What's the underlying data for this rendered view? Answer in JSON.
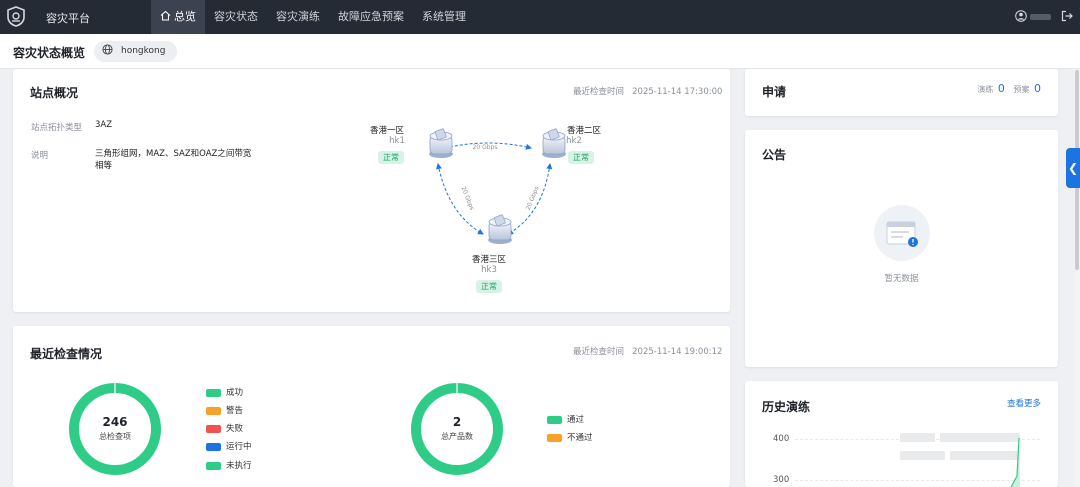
{
  "app": {
    "title": "容灾平台"
  },
  "nav": [
    {
      "label": "总览",
      "active": true
    },
    {
      "label": "容灾状态"
    },
    {
      "label": "容灾演练"
    },
    {
      "label": "故障应急预案"
    },
    {
      "label": "系统管理"
    }
  ],
  "page": {
    "title": "容灾状态概览",
    "region": "hongkong"
  },
  "site": {
    "title": "站点概况",
    "check_label": "最近检查时间",
    "check_time": "2025-11-14 17:30:00",
    "topology_label": "站点拓扑类型",
    "topology_value": "3AZ",
    "desc_label": "说明",
    "desc_value": "三角形组网，MAZ、SAZ和OAZ之间带宽相等",
    "link_speed": "20 Gbps",
    "nodes": [
      {
        "name": "香港一区",
        "code": "hk1",
        "status": "正常"
      },
      {
        "name": "香港二区",
        "code": "hk2",
        "status": "正常"
      },
      {
        "name": "香港三区",
        "code": "hk3",
        "status": "正常"
      }
    ]
  },
  "checks": {
    "title": "最近检查情况",
    "check_label": "最近检查时间",
    "check_time": "2025-11-14 19:00:12",
    "items_total": "246",
    "items_label": "总检查项",
    "items_legend": [
      {
        "label": "成功",
        "color": "#2ecc87"
      },
      {
        "label": "警告",
        "color": "#f7a12b"
      },
      {
        "label": "失败",
        "color": "#ef5350"
      },
      {
        "label": "运行中",
        "color": "#1c74e0"
      },
      {
        "label": "未执行",
        "color": "#2ecc87"
      }
    ],
    "products_total": "2",
    "products_label": "总产品数",
    "products_legend": [
      {
        "label": "通过",
        "color": "#2ecc87"
      },
      {
        "label": "不通过",
        "color": "#f7a12b"
      }
    ]
  },
  "apply": {
    "title": "申请",
    "drill_label": "演练",
    "drill_count": "0",
    "plan_label": "预案",
    "plan_count": "0"
  },
  "notice": {
    "title": "公告",
    "empty": "暂无数据"
  },
  "history": {
    "title": "历史演练",
    "more": "查看更多",
    "y_ticks": [
      "400",
      "300"
    ]
  },
  "icons": {
    "home": "home-icon",
    "user": "user-icon",
    "logout": "logout-icon",
    "globe": "globe-icon",
    "collapse": "chevron-left-icon"
  }
}
